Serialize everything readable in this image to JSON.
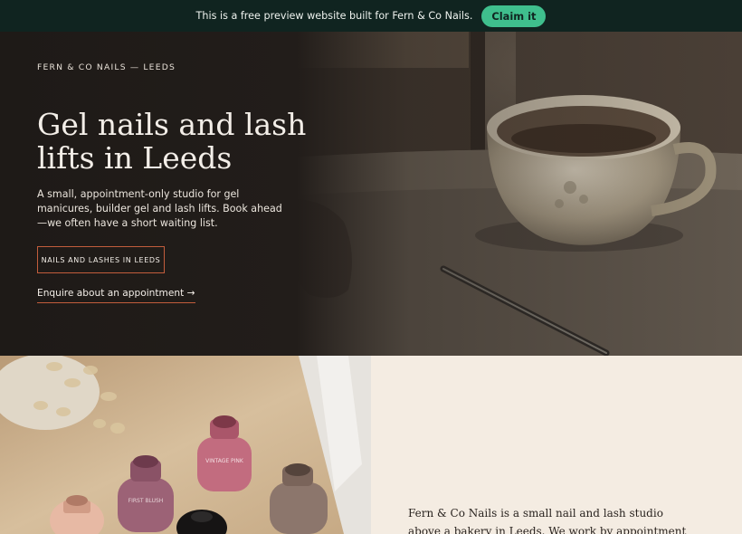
{
  "banner": {
    "message": "This is a free preview website built for Fern & Co Nails.",
    "cta_label": "Claim it"
  },
  "hero": {
    "eyebrow": "FERN & CO NAILS — LEEDS",
    "headline": "Gel nails and lash lifts in Leeds",
    "lede": "A small, appointment-only studio for gel manicures, builder gel and lash lifts. Book ahead—we often have a short waiting list.",
    "primary_cta": "NAILS AND LASHES IN LEEDS",
    "secondary_cta": "Enquire about an appointment →"
  },
  "gallery": {
    "bottle_labels": [
      "FIRST BLUSH",
      "VINTAGE PINK"
    ]
  },
  "about": {
    "text": "Fern & Co Nails is a small nail and lash studio above a bakery in Leeds. We work by appointment only, with bookings made ahead"
  },
  "colors": {
    "banner_bg": "#102420",
    "claim_button": "#3fbf8d",
    "accent": "#c25d3c",
    "hero_bg": "#221d1a",
    "cream": "#f4ece2"
  }
}
